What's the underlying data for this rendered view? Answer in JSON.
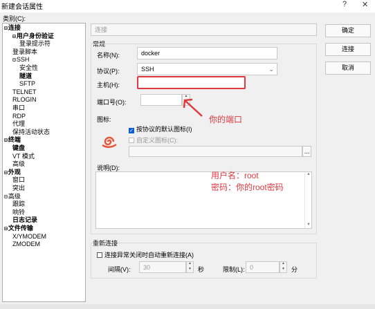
{
  "window": {
    "title": "新建会话属性",
    "help": "?",
    "close": "✕"
  },
  "category_label": "类别(C):",
  "tree": [
    {
      "label": "连接",
      "level": 0,
      "expander": "⊟",
      "bold": true
    },
    {
      "label": "用户身份验证",
      "level": 1,
      "expander": "⊟",
      "bold": true
    },
    {
      "label": "登录提示符",
      "level": 2,
      "expander": "",
      "bold": false
    },
    {
      "label": "登录脚本",
      "level": 1,
      "expander": "",
      "bold": false
    },
    {
      "label": "SSH",
      "level": 1,
      "expander": "⊟",
      "bold": false
    },
    {
      "label": "安全性",
      "level": 2,
      "expander": "",
      "bold": false
    },
    {
      "label": "隧道",
      "level": 2,
      "expander": "",
      "bold": true
    },
    {
      "label": "SFTP",
      "level": 2,
      "expander": "",
      "bold": false
    },
    {
      "label": "TELNET",
      "level": 1,
      "expander": "",
      "bold": false
    },
    {
      "label": "RLOGIN",
      "level": 1,
      "expander": "",
      "bold": false
    },
    {
      "label": "串口",
      "level": 1,
      "expander": "",
      "bold": false
    },
    {
      "label": "RDP",
      "level": 1,
      "expander": "",
      "bold": false
    },
    {
      "label": "代理",
      "level": 1,
      "expander": "",
      "bold": false
    },
    {
      "label": "保持活动状态",
      "level": 1,
      "expander": "",
      "bold": false
    },
    {
      "label": "终端",
      "level": 0,
      "expander": "⊟",
      "bold": true
    },
    {
      "label": "键盘",
      "level": 1,
      "expander": "",
      "bold": true
    },
    {
      "label": "VT 模式",
      "level": 1,
      "expander": "",
      "bold": false
    },
    {
      "label": "高级",
      "level": 1,
      "expander": "",
      "bold": false
    },
    {
      "label": "外观",
      "level": 0,
      "expander": "⊟",
      "bold": true
    },
    {
      "label": "窗口",
      "level": 1,
      "expander": "",
      "bold": false
    },
    {
      "label": "突出",
      "level": 1,
      "expander": "",
      "bold": false
    },
    {
      "label": "高级",
      "level": 0,
      "expander": "⊟",
      "bold": false
    },
    {
      "label": "跟踪",
      "level": 1,
      "expander": "",
      "bold": false
    },
    {
      "label": "响铃",
      "level": 1,
      "expander": "",
      "bold": false
    },
    {
      "label": "日志记录",
      "level": 1,
      "expander": "",
      "bold": true
    },
    {
      "label": "文件传输",
      "level": 0,
      "expander": "⊟",
      "bold": true
    },
    {
      "label": "X/YMODEM",
      "level": 1,
      "expander": "",
      "bold": false
    },
    {
      "label": "ZMODEM",
      "level": 1,
      "expander": "",
      "bold": false
    }
  ],
  "section": {
    "header": "连接",
    "general": "常规",
    "reconnect": "重新连接"
  },
  "form": {
    "name_label": "名称(N):",
    "name_value": "docker",
    "protocol_label": "协议(P):",
    "protocol_value": "SSH",
    "host_label": "主机(H):",
    "host_value": "",
    "port_label": "端口号(O):",
    "port_value": "",
    "icon_label": "图标:",
    "default_icon_label": "按协议的默认图标(I)",
    "custom_icon_label": "自定义图标(C):",
    "browse_label": "...",
    "desc_label": "说明(D):",
    "reconnect_label": "连接异常关闭时自动重新连接(A)",
    "interval_label": "间隔(V):",
    "interval_value": "30",
    "interval_unit": "秒",
    "limit_label": "限制(L):",
    "limit_value": "0",
    "limit_unit": "分"
  },
  "buttons": {
    "ok": "确定",
    "connect": "连接",
    "cancel": "取消"
  },
  "annotations": {
    "port_note": "你的端口",
    "cred_line1": "用户名：root",
    "cred_line2": "密码：你的root密码"
  },
  "colors": {
    "annotation": "#e0383f",
    "accent": "#0a5fd3"
  }
}
